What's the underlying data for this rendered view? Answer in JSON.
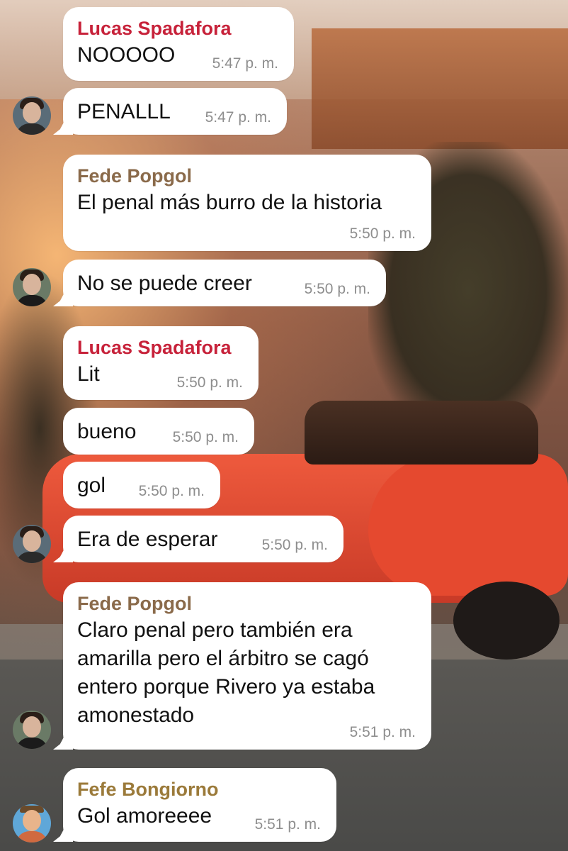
{
  "messages": [
    {
      "sender": "Lucas Spadafora",
      "text": "NOOOOO",
      "time": "5:47 p. m."
    },
    {
      "sender": "",
      "text": "PENALLL",
      "time": "5:47 p. m."
    },
    {
      "sender": "Fede Popgol",
      "text": "El penal más burro de la historia",
      "time": "5:50 p. m."
    },
    {
      "sender": "",
      "text": "No se puede creer",
      "time": "5:50 p. m."
    },
    {
      "sender": "Lucas Spadafora",
      "text": "Lit",
      "time": "5:50 p. m."
    },
    {
      "sender": "",
      "text": "bueno",
      "time": "5:50 p. m."
    },
    {
      "sender": "",
      "text": "gol",
      "time": "5:50 p. m."
    },
    {
      "sender": "",
      "text": "Era de esperar",
      "time": "5:50 p. m."
    },
    {
      "sender": "Fede Popgol",
      "text": "Claro penal pero también era\namarilla pero el árbitro se cagó\nentero porque Rivero ya estaba\namonestado",
      "time": "5:51 p. m."
    },
    {
      "sender": "Fefe Bongiorno",
      "text": "Gol amoreeee",
      "time": "5:51 p. m."
    }
  ],
  "colors": {
    "lucas": "#c7223a",
    "fede": "#8a6a4a",
    "fefe": "#9b7a3a",
    "bubble": "#ffffff",
    "time": "#8e8e8e"
  }
}
